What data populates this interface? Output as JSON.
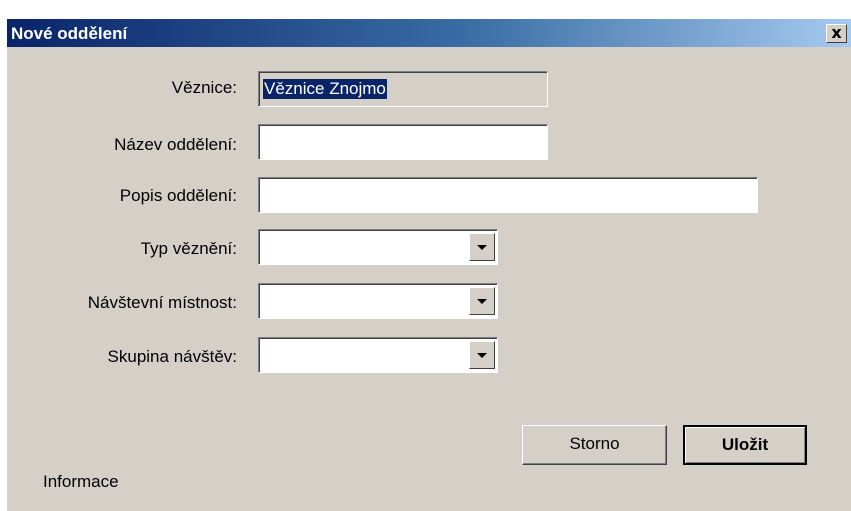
{
  "window": {
    "title": "Nové oddělení",
    "close_glyph": "✕"
  },
  "form": {
    "fields": [
      {
        "label": "Věznice:",
        "value": "Věznice Znojmo",
        "readonly": true
      },
      {
        "label": "Název oddělení:",
        "value": ""
      },
      {
        "label": "Popis oddělení:",
        "value": ""
      },
      {
        "label": "Typ věznění:",
        "value": ""
      },
      {
        "label": "Návštevní místnost:",
        "value": ""
      },
      {
        "label": "Skupina návštěv:",
        "value": ""
      }
    ]
  },
  "buttons": {
    "cancel_label": "Storno",
    "save_label": "Uložit"
  },
  "status": {
    "info_label": "Informace"
  },
  "colors": {
    "title_gradient_start": "#0a246a",
    "title_gradient_end": "#a6caf0",
    "dialog_background": "#d4d0c8",
    "selection_background": "#0a246a"
  }
}
